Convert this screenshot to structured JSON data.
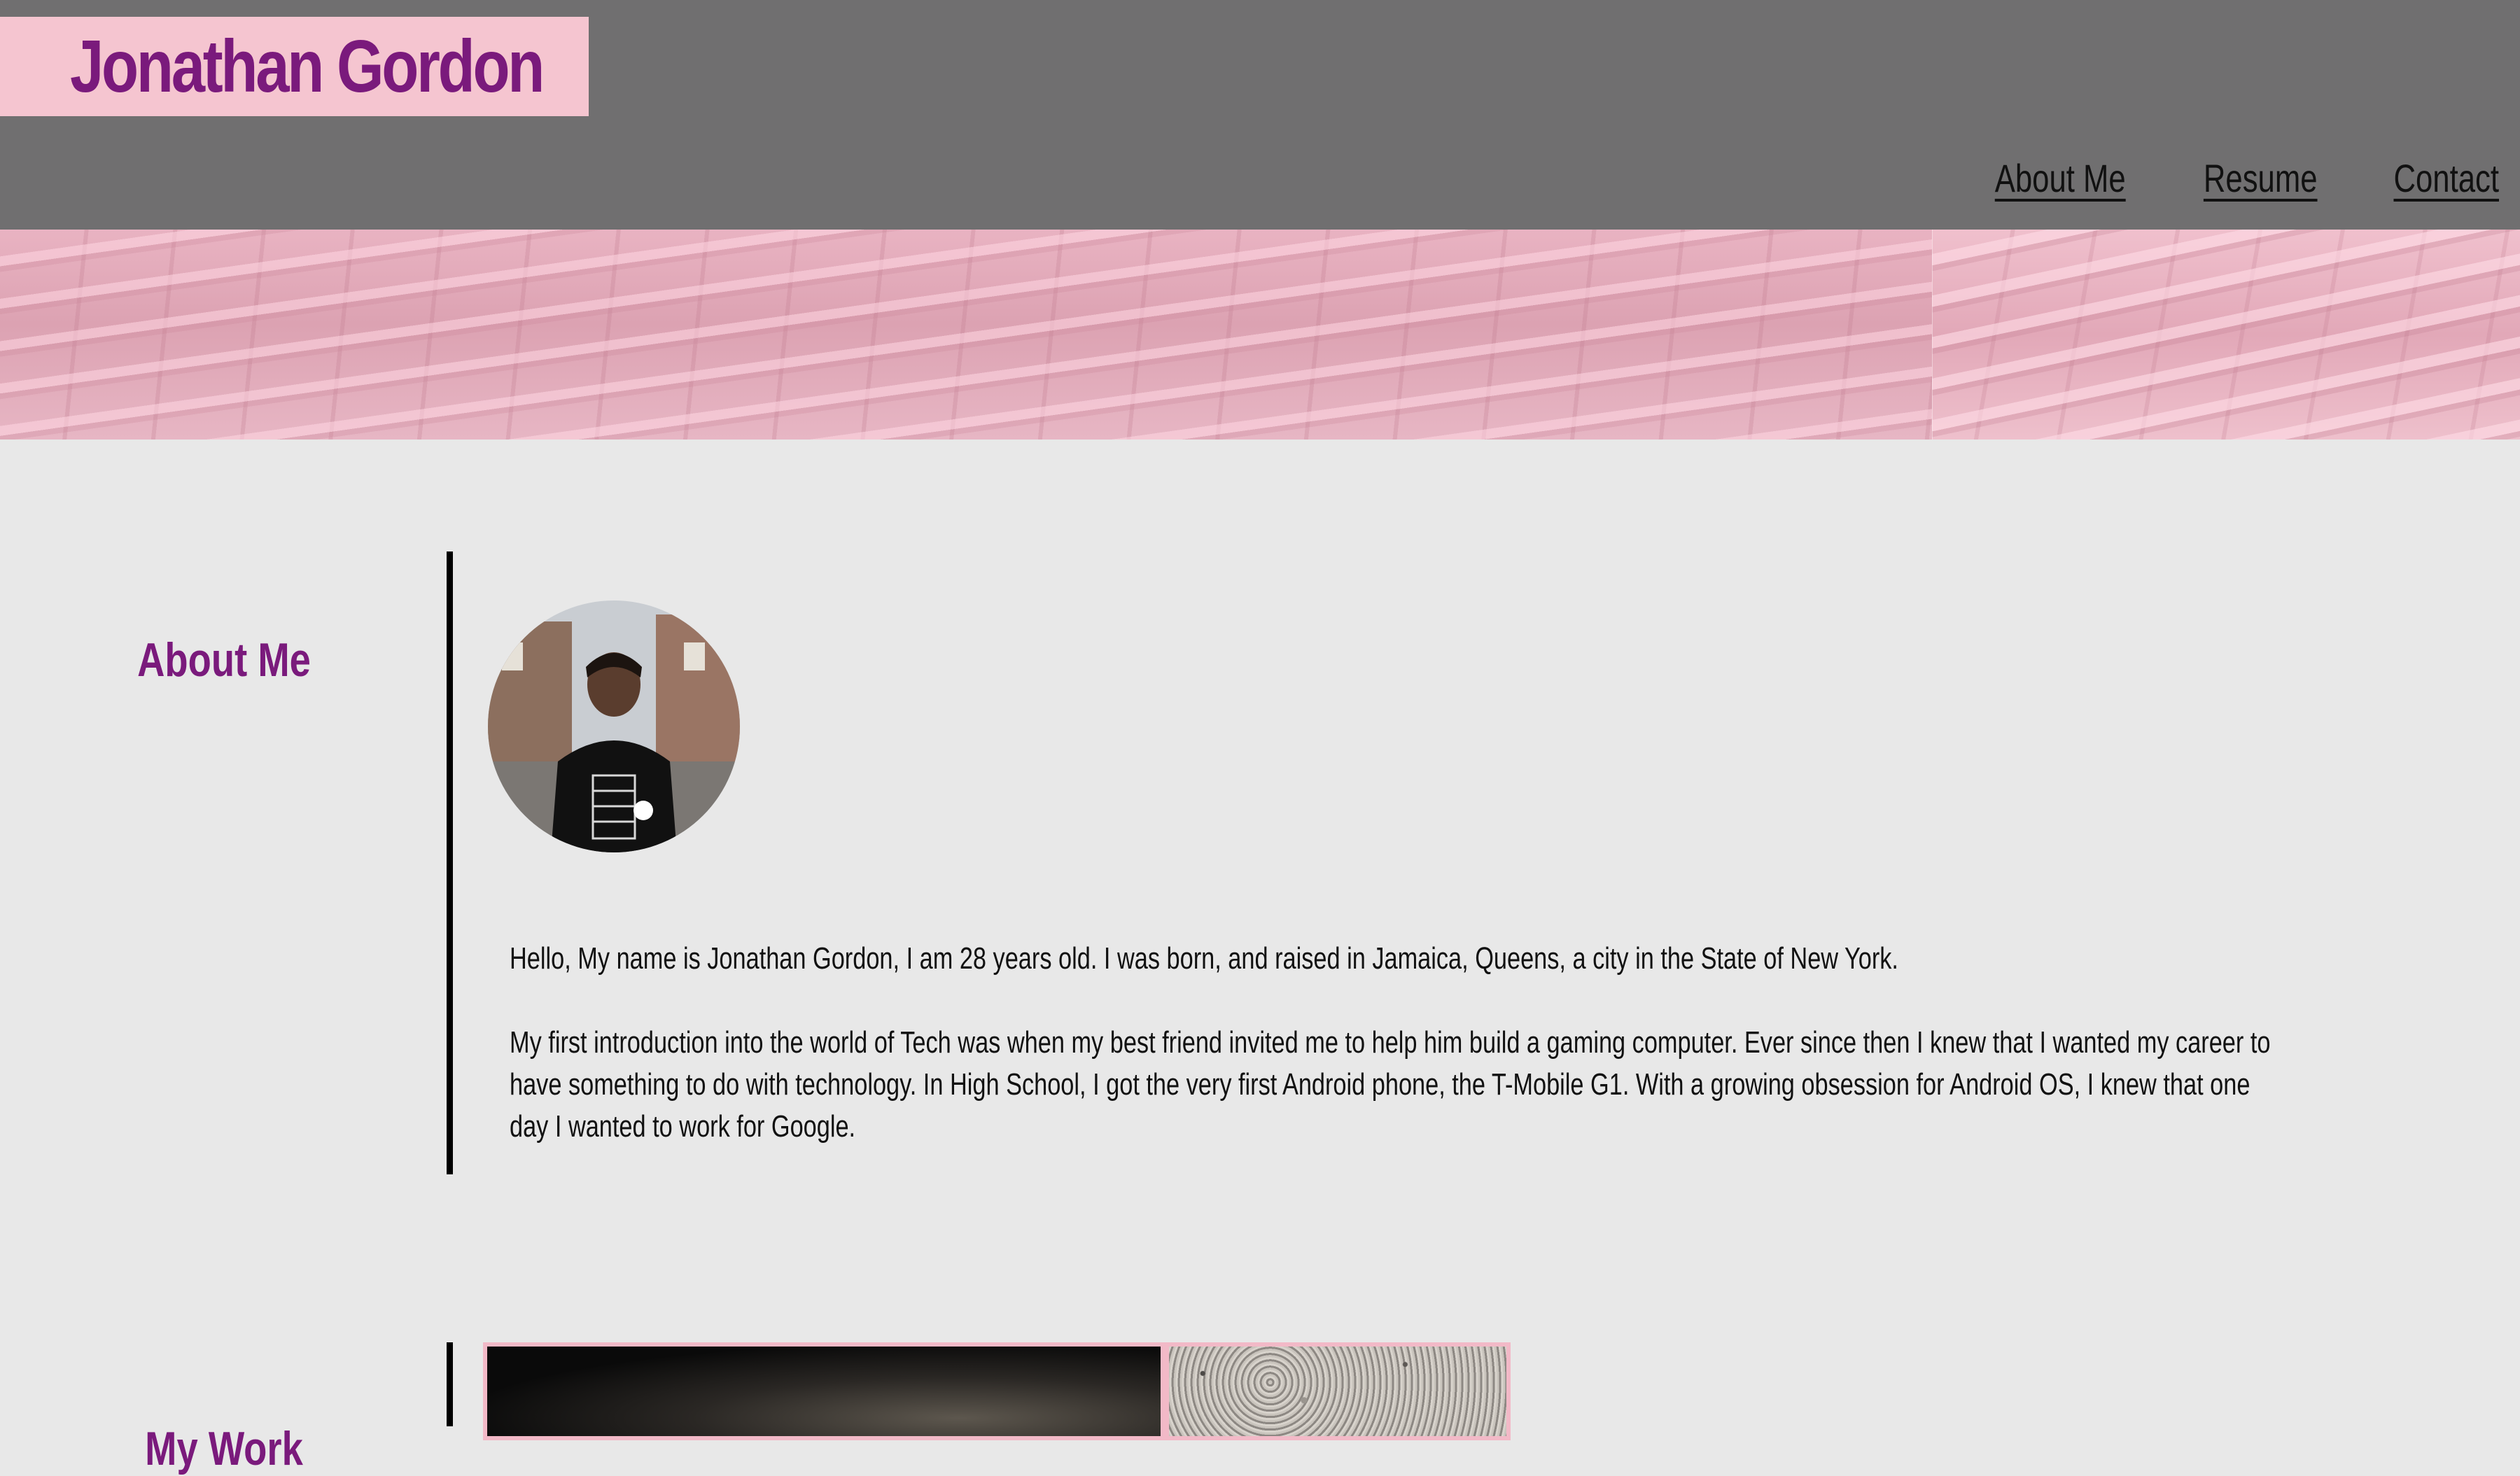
{
  "header": {
    "brand_name": "Jonathan Gordon",
    "nav": [
      {
        "label": "About Me"
      },
      {
        "label": "Resume"
      },
      {
        "label": "Contact"
      }
    ]
  },
  "about": {
    "title": "About Me",
    "paragraphs": [
      "Hello, My name is Jonathan Gordon, I am 28 years old. I was born, and raised in Jamaica, Queens, a city in the State of New York.",
      "My first introduction into the world of Tech was when my best friend invited me to help him build a gaming computer. Ever since then I knew that I wanted my career to have something to do with technology. In High School, I got the very first Android phone, the T-Mobile G1. With a growing obsession for Android OS, I knew that one day I wanted to work for Google."
    ]
  },
  "work": {
    "title": "My Work"
  },
  "colors": {
    "header_bg": "#706f70",
    "brand_bg": "#f5c5d0",
    "accent_purple": "#7a1a7c",
    "page_bg": "#e8e8e8",
    "thumb_border": "#f2b9c7"
  }
}
